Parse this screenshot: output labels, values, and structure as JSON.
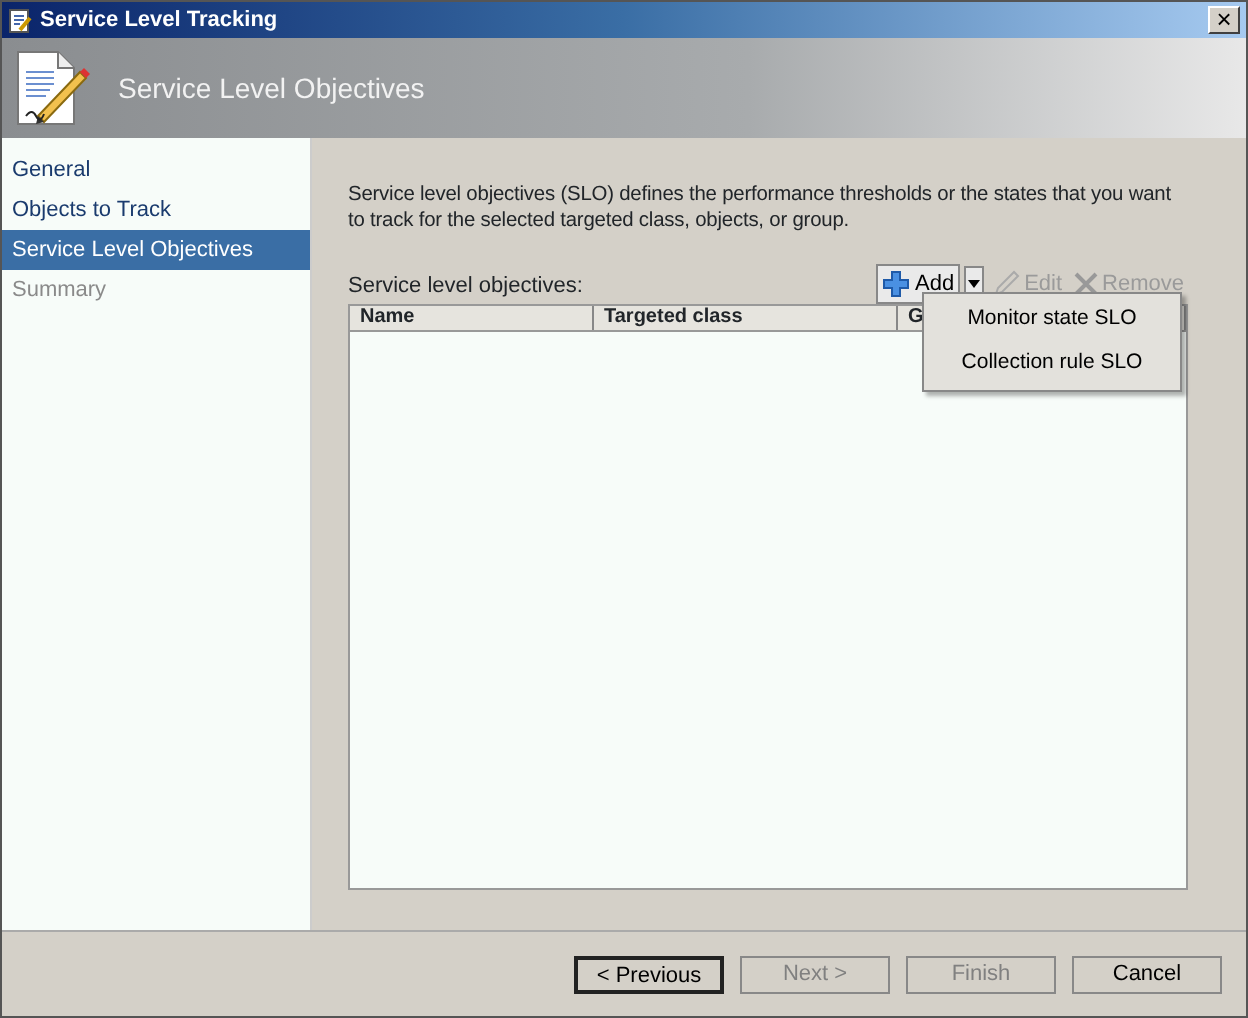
{
  "window": {
    "title": "Service Level Tracking",
    "close": "×"
  },
  "header": {
    "title": "Service Level Objectives"
  },
  "sidebar": {
    "items": [
      {
        "label": "General",
        "selected": false,
        "disabled": false
      },
      {
        "label": "Objects to Track",
        "selected": false,
        "disabled": false
      },
      {
        "label": "Service Level Objectives",
        "selected": true,
        "disabled": false
      },
      {
        "label": "Summary",
        "selected": false,
        "disabled": true
      }
    ]
  },
  "description": "Service level objectives (SLO) defines the performance thresholds or the states that you want to track for the selected targeted class, objects, or group.",
  "list_label": "Service level objectives:",
  "toolbar": [
    {
      "kind": "add",
      "label": "Add",
      "disabled": false
    },
    {
      "kind": "dropdown"
    },
    {
      "kind": "edit",
      "label": "Edit",
      "disabled": true
    },
    {
      "kind": "remove",
      "label": "Remove",
      "disabled": true
    }
  ],
  "table": {
    "columns": [
      "Name",
      "Targeted class",
      "G"
    ]
  },
  "menu": {
    "items": [
      "Monitor state SLO",
      "Collection rule SLO"
    ]
  },
  "buttons": [
    {
      "label": "< Previous",
      "disabled": false
    },
    {
      "label": "Next >",
      "disabled": true
    },
    {
      "label": "Finish",
      "disabled": true
    },
    {
      "label": "Cancel",
      "disabled": false
    }
  ]
}
